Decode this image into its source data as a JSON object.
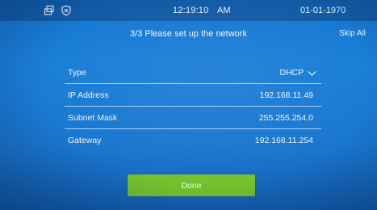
{
  "status": {
    "time": "12:19:10",
    "ampm": "AM",
    "date": "01-01-1970",
    "icons": [
      "window-icon",
      "shield-icon"
    ]
  },
  "header": {
    "title": "3/3 Please set up the network",
    "skip_label": "Skip All"
  },
  "form": {
    "type_label": "Type",
    "type_value": "DHCP",
    "ip_label": "IP Address",
    "ip_value": "192.168.11.49",
    "mask_label": "Subnet Mask",
    "mask_value": "255.255.254.0",
    "gateway_label": "Gateway",
    "gateway_value": "192.168.11.254"
  },
  "actions": {
    "done_label": "Done"
  },
  "colors": {
    "background": "#1a77cf",
    "done_button": "#74c32e"
  }
}
